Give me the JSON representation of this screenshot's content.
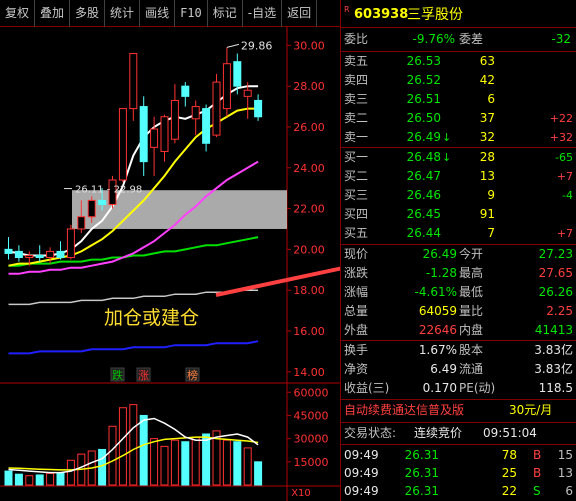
{
  "toolbar": {
    "buttons": [
      "复权",
      "叠加",
      "多股",
      "统计",
      "画线",
      "F10",
      "标记",
      "-自选",
      "返回"
    ]
  },
  "stock": {
    "flag": "R",
    "code": "603938",
    "name": "三孚股份"
  },
  "order_ratio": {
    "label1": "委比",
    "value1": "-9.76%",
    "label2": "委差",
    "value2": "-32"
  },
  "asks": [
    {
      "label": "卖五",
      "price": "26.53",
      "vol": "63",
      "chg": "",
      "arrow": ""
    },
    {
      "label": "卖四",
      "price": "26.52",
      "vol": "42",
      "chg": "",
      "arrow": ""
    },
    {
      "label": "卖三",
      "price": "26.51",
      "vol": "6",
      "chg": "",
      "arrow": ""
    },
    {
      "label": "卖二",
      "price": "26.50",
      "vol": "37",
      "chg": "+22",
      "arrow": ""
    },
    {
      "label": "卖一",
      "price": "26.49",
      "vol": "32",
      "chg": "+32",
      "arrow": "↓"
    }
  ],
  "bids": [
    {
      "label": "买一",
      "price": "26.48",
      "vol": "28",
      "chg": "-65",
      "arrow": "↓"
    },
    {
      "label": "买二",
      "price": "26.47",
      "vol": "13",
      "chg": "+7",
      "arrow": ""
    },
    {
      "label": "买三",
      "price": "26.46",
      "vol": "9",
      "chg": "-4",
      "arrow": ""
    },
    {
      "label": "买四",
      "price": "26.45",
      "vol": "91",
      "chg": "",
      "arrow": ""
    },
    {
      "label": "买五",
      "price": "26.44",
      "vol": "7",
      "chg": "+7",
      "arrow": ""
    }
  ],
  "quote": [
    {
      "l1": "现价",
      "v1": "26.49",
      "l2": "今开",
      "v2": "27.23"
    },
    {
      "l1": "涨跌",
      "v1": "-1.28",
      "l2": "最高",
      "v2": "27.65"
    },
    {
      "l1": "涨幅",
      "v1": "-4.61%",
      "l2": "最低",
      "v2": "26.26"
    },
    {
      "l1": "总量",
      "v1": "64059",
      "l2": "量比",
      "v2": "2.25"
    },
    {
      "l1": "外盘",
      "v1": "22646",
      "l2": "内盘",
      "v2": "41413"
    }
  ],
  "fundamentals": [
    {
      "l1": "换手",
      "v1": "1.67%",
      "l2": "股本",
      "v2": "3.83亿"
    },
    {
      "l1": "净资",
      "v1": "6.49",
      "l2": "流通",
      "v2": "3.83亿"
    },
    {
      "l1": "收益(三)",
      "v1": "0.170",
      "l2": "PE(动)",
      "v2": "118.5"
    }
  ],
  "ad": {
    "text": "自动续费通达信普及版",
    "price": "30元/月"
  },
  "trade_status": {
    "label": "交易状态:",
    "value": "连续竞价",
    "time": "09:51:04"
  },
  "ticks": [
    {
      "time": "09:49",
      "price": "26.31",
      "vol": "78",
      "side": "B",
      "n": "15"
    },
    {
      "time": "09:49",
      "price": "26.31",
      "vol": "25",
      "side": "B",
      "n": "13"
    },
    {
      "time": "09:49",
      "price": "26.31",
      "vol": "22",
      "side": "S",
      "n": "6"
    }
  ],
  "annotation": {
    "text": "加仓或建仓"
  },
  "chart_labels": {
    "high": "29.86",
    "range": "26.11 - 22.98",
    "badges": [
      "跌",
      "涨",
      "榜"
    ],
    "vol_unit": "X10"
  },
  "chart_data": {
    "type": "candlestick",
    "price_axis": [
      "30.00",
      "28.00",
      "26.00",
      "24.00",
      "22.00",
      "20.00",
      "18.00",
      "16.00",
      "14.00"
    ],
    "price_range": [
      13.4,
      30.9
    ],
    "volume_axis": [
      "60000",
      "45000",
      "30000",
      "15000"
    ],
    "volume_range": [
      0,
      66000
    ],
    "candles": [
      {
        "o": 20.0,
        "h": 20.6,
        "l": 19.5,
        "c": 19.8,
        "v": 9000
      },
      {
        "o": 19.9,
        "h": 20.2,
        "l": 19.4,
        "c": 19.6,
        "v": 7000
      },
      {
        "o": 19.6,
        "h": 19.9,
        "l": 19.2,
        "c": 19.7,
        "v": 6000
      },
      {
        "o": 19.7,
        "h": 20.2,
        "l": 19.4,
        "c": 19.6,
        "v": 6500
      },
      {
        "o": 19.6,
        "h": 20.1,
        "l": 19.3,
        "c": 19.9,
        "v": 7500
      },
      {
        "o": 19.9,
        "h": 20.4,
        "l": 19.5,
        "c": 19.6,
        "v": 8000
      },
      {
        "o": 19.6,
        "h": 21.2,
        "l": 19.5,
        "c": 21.0,
        "v": 16000
      },
      {
        "o": 21.0,
        "h": 22.4,
        "l": 20.8,
        "c": 21.6,
        "v": 20000
      },
      {
        "o": 21.6,
        "h": 22.6,
        "l": 21.3,
        "c": 22.4,
        "v": 22000
      },
      {
        "o": 22.4,
        "h": 23.0,
        "l": 21.9,
        "c": 22.2,
        "v": 23000
      },
      {
        "o": 22.2,
        "h": 23.6,
        "l": 22.0,
        "c": 23.4,
        "v": 38000
      },
      {
        "o": 23.4,
        "h": 26.9,
        "l": 23.3,
        "c": 26.9,
        "v": 50000
      },
      {
        "o": 26.9,
        "h": 29.6,
        "l": 26.3,
        "c": 29.6,
        "v": 52000
      },
      {
        "o": 27.0,
        "h": 27.5,
        "l": 23.6,
        "c": 24.3,
        "v": 45000
      },
      {
        "o": 25.0,
        "h": 26.5,
        "l": 23.6,
        "c": 25.9,
        "v": 30000
      },
      {
        "o": 24.8,
        "h": 26.6,
        "l": 24.3,
        "c": 26.5,
        "v": 25000
      },
      {
        "o": 25.4,
        "h": 28.1,
        "l": 25.2,
        "c": 27.3,
        "v": 29000
      },
      {
        "o": 28.0,
        "h": 28.2,
        "l": 27.0,
        "c": 27.5,
        "v": 28000
      },
      {
        "o": 26.4,
        "h": 27.3,
        "l": 25.6,
        "c": 27.0,
        "v": 31000
      },
      {
        "o": 26.9,
        "h": 27.1,
        "l": 24.8,
        "c": 25.2,
        "v": 33000
      },
      {
        "o": 25.6,
        "h": 28.6,
        "l": 25.5,
        "c": 28.2,
        "v": 35000
      },
      {
        "o": 26.9,
        "h": 29.9,
        "l": 26.5,
        "c": 29.1,
        "v": 29000
      },
      {
        "o": 29.2,
        "h": 29.6,
        "l": 27.6,
        "c": 28.0,
        "v": 28000
      },
      {
        "o": 27.5,
        "h": 28.2,
        "l": 26.4,
        "c": 27.8,
        "v": 24000
      },
      {
        "o": 27.3,
        "h": 27.6,
        "l": 26.3,
        "c": 26.5,
        "v": 15000
      }
    ],
    "ma5": [
      19.9,
      19.8,
      19.7,
      19.7,
      19.7,
      19.8,
      20.0,
      20.4,
      21.0,
      21.4,
      22.1,
      23.1,
      24.6,
      25.5,
      26.0,
      26.3,
      26.5,
      26.4,
      26.6,
      26.8,
      27.2,
      27.6,
      27.9,
      28.0,
      28.0
    ],
    "ma10": [
      19.2,
      19.3,
      19.3,
      19.4,
      19.5,
      19.6,
      19.7,
      19.9,
      20.2,
      20.5,
      20.9,
      21.4,
      21.9,
      22.4,
      23.0,
      23.6,
      24.3,
      24.9,
      25.5,
      25.9,
      26.2,
      26.5,
      26.8,
      26.9,
      26.9
    ],
    "ma20": [
      18.8,
      18.8,
      18.9,
      18.9,
      19.0,
      19.0,
      19.1,
      19.1,
      19.2,
      19.3,
      19.4,
      19.6,
      19.8,
      20.1,
      20.4,
      20.8,
      21.2,
      21.7,
      22.1,
      22.6,
      23.0,
      23.4,
      23.7,
      24.0,
      24.3
    ],
    "ma60": [
      19.2,
      19.2,
      19.3,
      19.3,
      19.3,
      19.4,
      19.4,
      19.4,
      19.5,
      19.5,
      19.6,
      19.6,
      19.7,
      19.7,
      19.8,
      19.9,
      19.9,
      20.0,
      20.1,
      20.2,
      20.2,
      20.3,
      20.4,
      20.5,
      20.6
    ],
    "ma120": [
      17.3,
      17.3,
      17.3,
      17.4,
      17.4,
      17.4,
      17.4,
      17.5,
      17.5,
      17.5,
      17.6,
      17.6,
      17.6,
      17.7,
      17.7,
      17.7,
      17.8,
      17.8,
      17.8,
      17.9,
      17.9,
      17.9,
      18.0,
      18.0,
      18.0
    ],
    "ma250": [
      14.9,
      14.9,
      14.9,
      15.0,
      15.0,
      15.0,
      15.0,
      15.0,
      15.1,
      15.1,
      15.1,
      15.1,
      15.2,
      15.2,
      15.2,
      15.2,
      15.3,
      15.3,
      15.3,
      15.3,
      15.4,
      15.4,
      15.4,
      15.4,
      15.5
    ],
    "vol_ma5": [
      10000,
      9500,
      9000,
      8500,
      8000,
      8000,
      9000,
      11500,
      14500,
      17000,
      23000,
      30000,
      37000,
      42000,
      43000,
      40000,
      36000,
      31000,
      29000,
      29000,
      31000,
      32000,
      33000,
      31000,
      26000
    ],
    "vol_ma10": [
      11000,
      10800,
      10500,
      10200,
      10000,
      9800,
      9800,
      10200,
      11000,
      12500,
      15500,
      19000,
      23000,
      26000,
      28000,
      29500,
      30000,
      30500,
      31000,
      31000,
      30000,
      29500,
      29000,
      28500,
      27500
    ],
    "support_zone": [
      21.0,
      22.9
    ],
    "colors": {
      "up": "#ff3232",
      "down": "#54ffff",
      "ma5": "#ffffff",
      "ma10": "#ffff00",
      "ma20": "#ff40ff",
      "ma60": "#00e000",
      "ma120": "#c8c8c8",
      "ma250": "#2020ff",
      "axis": "#b00000",
      "zone": "#c8c8c8",
      "arrow": "#ff4040"
    }
  }
}
